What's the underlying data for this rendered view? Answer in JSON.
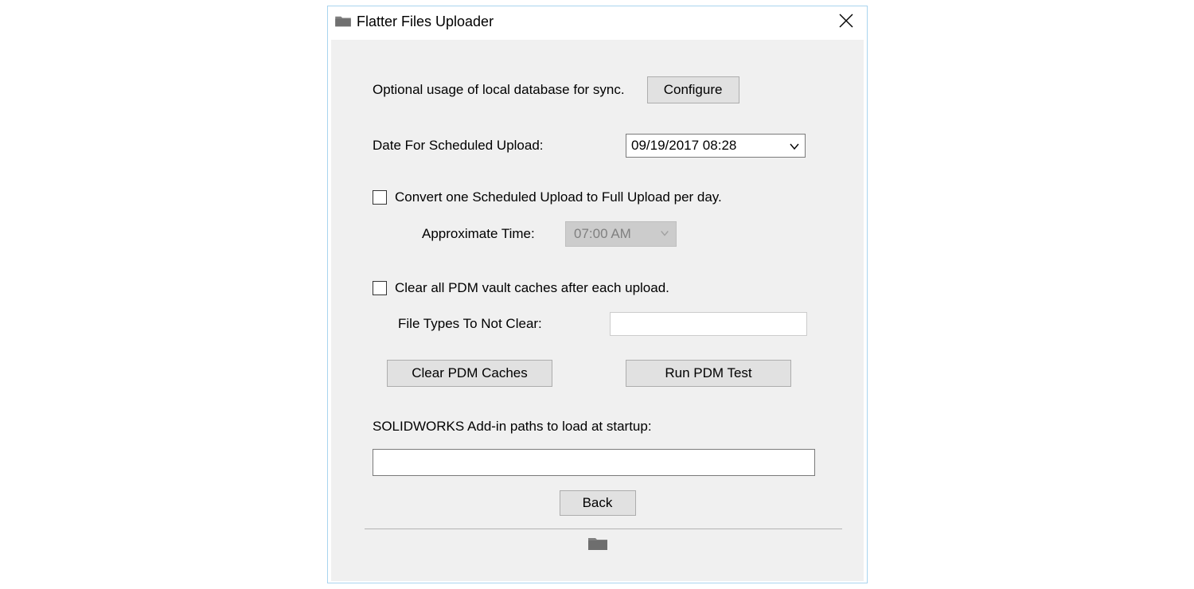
{
  "window": {
    "title": "Flatter Files Uploader"
  },
  "sync": {
    "label": "Optional usage of local database for sync.",
    "configure_button": "Configure"
  },
  "schedule": {
    "date_label": "Date For Scheduled Upload:",
    "date_value": "09/19/2017 08:28",
    "convert_label": "Convert one Scheduled Upload to Full Upload per day.",
    "approx_time_label": "Approximate Time:",
    "approx_time_value": "07:00 AM"
  },
  "pdm": {
    "clear_label": "Clear all PDM vault caches after each upload.",
    "file_types_label": "File Types To Not Clear:",
    "file_types_value": "",
    "clear_button": "Clear PDM Caches",
    "test_button": "Run PDM Test"
  },
  "solidworks": {
    "label": "SOLIDWORKS Add-in paths to load at startup:",
    "value": ""
  },
  "footer": {
    "back_button": "Back"
  }
}
